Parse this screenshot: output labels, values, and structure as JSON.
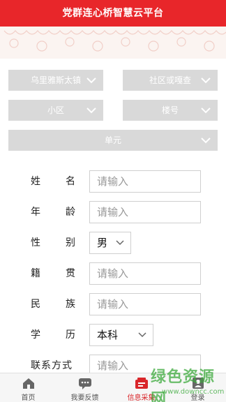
{
  "header": {
    "title": "党群连心桥智慧云平台"
  },
  "filters": {
    "town": "乌里雅斯太镇",
    "community": "社区或嘎查",
    "district": "小区",
    "building": "楼号",
    "unit": "单元"
  },
  "form": {
    "name": {
      "label_a": "姓",
      "label_b": "名",
      "placeholder": "请输入"
    },
    "age": {
      "label_a": "年",
      "label_b": "龄",
      "placeholder": "请输入"
    },
    "gender": {
      "label_a": "性",
      "label_b": "别",
      "value": "男"
    },
    "origin": {
      "label_a": "籍",
      "label_b": "贯",
      "placeholder": "请输入"
    },
    "ethnicity": {
      "label_a": "民",
      "label_b": "族",
      "placeholder": "请输入"
    },
    "education": {
      "label_a": "学",
      "label_b": "历",
      "value": "本科"
    },
    "contact": {
      "label": "联系方式",
      "placeholder": "请输入"
    }
  },
  "tabbar": {
    "items": [
      {
        "label": "首页",
        "icon": "home-icon"
      },
      {
        "label": "我要反馈",
        "icon": "chat-icon"
      },
      {
        "label": "信息采集",
        "icon": "collect-icon",
        "active": true
      },
      {
        "label": "登录",
        "icon": "login-icon"
      }
    ]
  },
  "watermark": {
    "main": "绿色资源网",
    "url": "www.downcc.com"
  },
  "colors": {
    "brand_red": "#e8262a",
    "select_gray": "#d9d9d9"
  }
}
